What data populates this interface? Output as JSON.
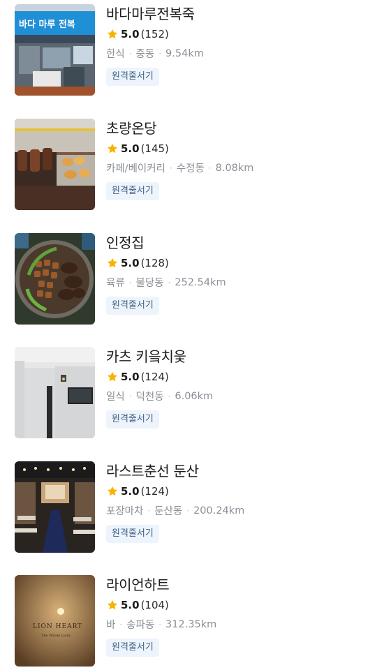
{
  "restaurants": [
    {
      "name": "바다마루전복죽",
      "score": "5.0",
      "count": "(152)",
      "category": "한식",
      "area": "중동",
      "distance": "9.54km",
      "badge": "원격줄서기"
    },
    {
      "name": "초량온당",
      "score": "5.0",
      "count": "(145)",
      "category": "카페/베이커리",
      "area": "수정동",
      "distance": "8.08km",
      "badge": "원격줄서기"
    },
    {
      "name": "인정집",
      "score": "5.0",
      "count": "(128)",
      "category": "육류",
      "area": "불당동",
      "distance": "252.54km",
      "badge": "원격줄서기"
    },
    {
      "name": "카츠 키읔치읓",
      "score": "5.0",
      "count": "(124)",
      "category": "일식",
      "area": "덕천동",
      "distance": "6.06km",
      "badge": "원격줄서기"
    },
    {
      "name": "라스트춘선 둔산",
      "score": "5.0",
      "count": "(124)",
      "category": "포장마차",
      "area": "둔산동",
      "distance": "200.24km",
      "badge": "원격줄서기"
    },
    {
      "name": "라이언하트",
      "score": "5.0",
      "count": "(104)",
      "category": "바",
      "area": "송파동",
      "distance": "312.35km",
      "badge": "원격줄서기"
    }
  ],
  "thumb_texts": {
    "sign1": "바다 마루 전복",
    "lion": "LION HEART",
    "lion_sub": "The Whole Lions"
  },
  "colors": {
    "star": "#f5b400",
    "badge_bg": "#eef4fb",
    "badge_text": "#3d5f86",
    "meta": "#8a8f96"
  },
  "icons": {
    "rating": "star-icon"
  }
}
